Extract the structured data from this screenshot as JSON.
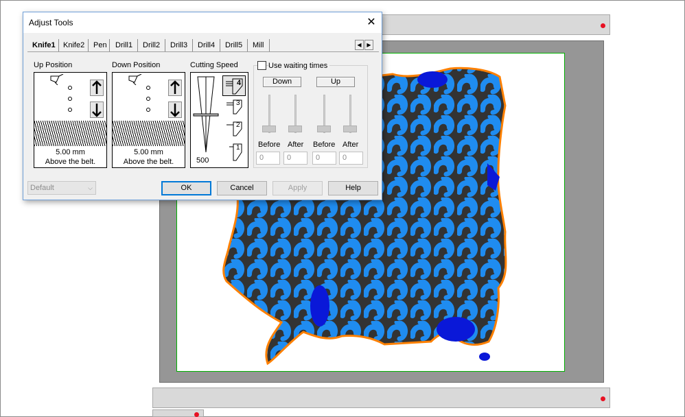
{
  "dialog": {
    "title": "Adjust Tools",
    "close_glyph": "✕",
    "tabs": [
      "Knife1",
      "Knife2",
      "Pen",
      "Drill1",
      "Drill2",
      "Drill3",
      "Drill4",
      "Drill5",
      "Mill"
    ],
    "active_tab": "Knife1",
    "tab_scroll_left": "◀",
    "tab_scroll_right": "▶",
    "up_position": {
      "label": "Up Position",
      "value": "5.00 mm",
      "note": "Above the belt."
    },
    "down_position": {
      "label": "Down Position",
      "value": "5.00 mm",
      "note": "Above the belt."
    },
    "cutting_speed": {
      "label": "Cutting Speed",
      "value": "500",
      "levels": [
        "4",
        "3",
        "2",
        "1"
      ],
      "selected_level": "4"
    },
    "waiting": {
      "checkbox_label": "Use waiting times",
      "checked": false,
      "down_label": "Down",
      "up_label": "Up",
      "before_label": "Before",
      "after_label": "After",
      "values": [
        "0",
        "0",
        "0",
        "0"
      ]
    },
    "preset": {
      "value": "Default"
    },
    "buttons": {
      "ok": "OK",
      "cancel": "Cancel",
      "apply": "Apply",
      "help": "Help"
    }
  },
  "colors": {
    "hide_fill": "#1f8cf0",
    "hide_dark": "#0a18d8",
    "hide_bg": "#333333",
    "outline": "#ff8000",
    "frame_border": "#00b000",
    "canvas_gray": "#969696"
  },
  "icons": [
    "close-icon",
    "up-arrow-icon",
    "down-arrow-icon",
    "knife-icon",
    "speed-cone-icon"
  ]
}
